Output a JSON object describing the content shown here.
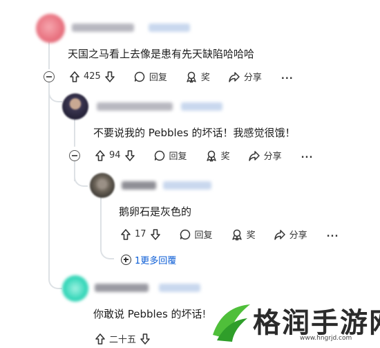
{
  "comments": [
    {
      "text": "天国之马看上去像是患有先天缺陷哈哈哈",
      "votes": "425",
      "reply_label": "回复",
      "award_label": "奖",
      "share_label": "分享",
      "more_label": "..."
    },
    {
      "text": "不要说我的 Pebbles 的坏话！我感觉很饿！",
      "votes": "94",
      "reply_label": "回复",
      "award_label": "奖",
      "share_label": "分享",
      "more_label": "..."
    },
    {
      "text": "鹅卵石是灰色的",
      "votes": "17",
      "reply_label": "回复",
      "award_label": "奖",
      "share_label": "分享",
      "more_label": "..."
    },
    {
      "text": "你敢说 Pebbles 的坏话!",
      "votes": "二十五"
    }
  ],
  "more_replies_label": "1更多回覆",
  "watermark": {
    "text": "格润手游网",
    "url": "www.hngrjd.com"
  },
  "colors": {
    "avatar1": "#e8707e",
    "avatar2": "#3a3550",
    "avatar3": "#6b6358",
    "avatar4": "#32d6b8",
    "link": "#0b5dd6",
    "thread_line": "#dde1e5"
  }
}
